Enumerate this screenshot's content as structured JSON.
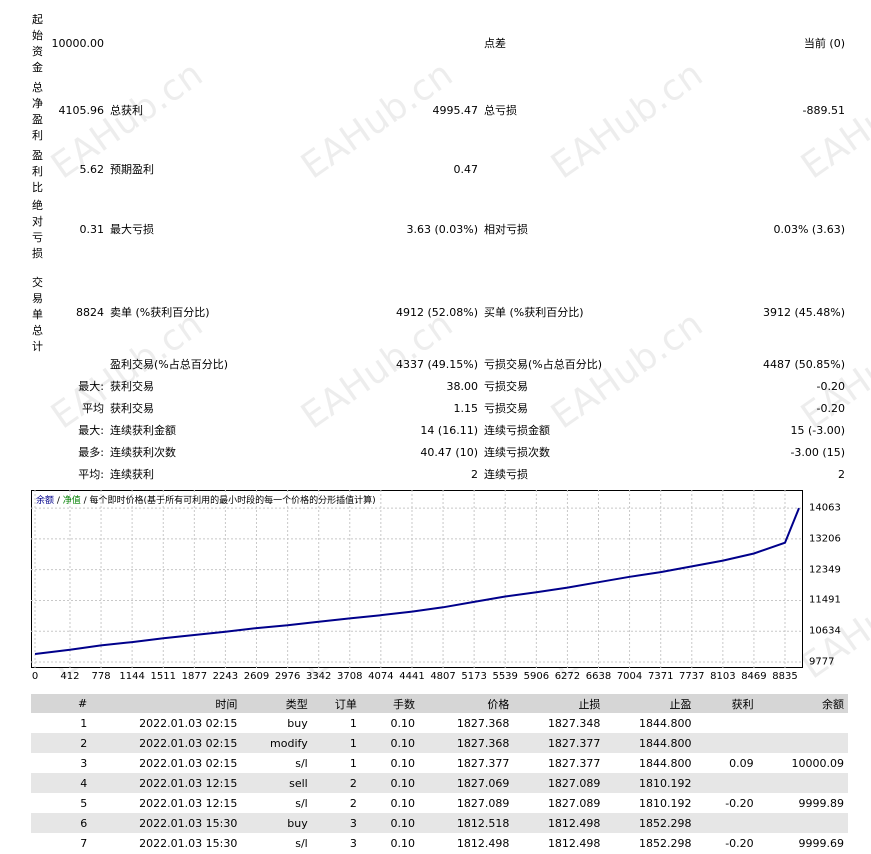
{
  "summary": {
    "initial_deposit": {
      "label": "起始资金",
      "value": "10000.00",
      "spread_label": "点差",
      "spread_value": "当前 (0)"
    },
    "total_net_profit": {
      "label": "总净盈利",
      "value": "4105.96",
      "gross_profit_label": "总获利",
      "gross_profit_value": "4995.47",
      "gross_loss_label": "总亏损",
      "gross_loss_value": "-889.51"
    },
    "profit_factor": {
      "label": "盈利比",
      "value": "5.62",
      "expected_label": "预期盈利",
      "expected_value": "0.47"
    },
    "absolute_drawdown": {
      "label": "绝对亏损",
      "value": "0.31",
      "maximal_label": "最大亏损",
      "maximal_value": "3.63 (0.03%)",
      "relative_label": "相对亏损",
      "relative_value": "0.03% (3.63)"
    },
    "total_trades": {
      "label": "交易单总计",
      "value": "8824",
      "short_label": "卖单 (%获利百分比)",
      "short_value": "4912 (52.08%)",
      "long_label": "买单 (%获利百分比)",
      "long_value": "3912 (45.48%)"
    },
    "profit_trades": {
      "label": "盈利交易(%占总百分比)",
      "value": "4337 (49.15%)",
      "loss_label": "亏损交易(%占总百分比)",
      "loss_value": "4487 (50.85%)"
    },
    "largest": {
      "prefix": "最大:",
      "profit_label": "获利交易",
      "profit_value": "38.00",
      "loss_label": "亏损交易",
      "loss_value": "-0.20"
    },
    "average": {
      "prefix": "平均",
      "profit_label": "获利交易",
      "profit_value": "1.15",
      "loss_label": "亏损交易",
      "loss_value": "-0.20"
    },
    "max_consec_amount": {
      "prefix": "最大:",
      "win_label": "连续获利金额",
      "win_value": "14 (16.11)",
      "loss_label": "连续亏损金额",
      "loss_value": "15 (-3.00)"
    },
    "max_consec_count": {
      "prefix": "最多:",
      "win_label": "连续获利次数",
      "win_value": "40.47 (10)",
      "loss_label": "连续亏损次数",
      "loss_value": "-3.00 (15)"
    },
    "avg_consec": {
      "prefix": "平均:",
      "win_label": "连续获利",
      "win_value": "2",
      "loss_label": "连续亏损",
      "loss_value": "2"
    }
  },
  "chart": {
    "legend_balance": "余额",
    "legend_sep1": " / ",
    "legend_equity": "净值",
    "legend_rest": " / 每个即时价格(基于所有可利用的最小时段的每一个价格的分形插值计算)",
    "balance_color": "#00008b",
    "equity_color": "#008000"
  },
  "chart_data": {
    "type": "line",
    "x_ticks": [
      "0",
      "412",
      "778",
      "1144",
      "1511",
      "1877",
      "2243",
      "2609",
      "2976",
      "3342",
      "3708",
      "4074",
      "4441",
      "4807",
      "5173",
      "5539",
      "5906",
      "6272",
      "6638",
      "7004",
      "7371",
      "7737",
      "8103",
      "8469",
      "8835"
    ],
    "y_ticks": [
      "14063",
      "13206",
      "12349",
      "11491",
      "10634",
      "9777"
    ],
    "xlim": [
      0,
      9000
    ],
    "ylim": [
      9777,
      14400
    ],
    "series": [
      {
        "values": [
          [
            0,
            10000
          ],
          [
            412,
            10120
          ],
          [
            778,
            10240
          ],
          [
            1144,
            10330
          ],
          [
            1511,
            10440
          ],
          [
            1877,
            10530
          ],
          [
            2243,
            10620
          ],
          [
            2609,
            10720
          ],
          [
            2976,
            10800
          ],
          [
            3342,
            10900
          ],
          [
            3708,
            10990
          ],
          [
            4074,
            11080
          ],
          [
            4441,
            11180
          ],
          [
            4807,
            11300
          ],
          [
            5173,
            11450
          ],
          [
            5539,
            11600
          ],
          [
            5906,
            11720
          ],
          [
            6272,
            11850
          ],
          [
            6638,
            12000
          ],
          [
            7004,
            12150
          ],
          [
            7371,
            12280
          ],
          [
            7737,
            12440
          ],
          [
            8103,
            12600
          ],
          [
            8469,
            12800
          ],
          [
            8835,
            13100
          ],
          [
            9000,
            14063
          ]
        ]
      }
    ]
  },
  "table": {
    "headers": [
      "#",
      "时间",
      "类型",
      "订单",
      "手数",
      "价格",
      "止损",
      "止盈",
      "获利",
      "余额"
    ],
    "rows": [
      [
        "1",
        "2022.01.03 02:15",
        "buy",
        "1",
        "0.10",
        "1827.368",
        "1827.348",
        "1844.800",
        "",
        ""
      ],
      [
        "2",
        "2022.01.03 02:15",
        "modify",
        "1",
        "0.10",
        "1827.368",
        "1827.377",
        "1844.800",
        "",
        ""
      ],
      [
        "3",
        "2022.01.03 02:15",
        "s/l",
        "1",
        "0.10",
        "1827.377",
        "1827.377",
        "1844.800",
        "0.09",
        "10000.09"
      ],
      [
        "4",
        "2022.01.03 12:15",
        "sell",
        "2",
        "0.10",
        "1827.069",
        "1827.089",
        "1810.192",
        "",
        ""
      ],
      [
        "5",
        "2022.01.03 12:15",
        "s/l",
        "2",
        "0.10",
        "1827.089",
        "1827.089",
        "1810.192",
        "-0.20",
        "9999.89"
      ],
      [
        "6",
        "2022.01.03 15:30",
        "buy",
        "3",
        "0.10",
        "1812.518",
        "1812.498",
        "1852.298",
        "",
        ""
      ],
      [
        "7",
        "2022.01.03 15:30",
        "s/l",
        "3",
        "0.10",
        "1812.498",
        "1812.498",
        "1852.298",
        "-0.20",
        "9999.69"
      ]
    ]
  },
  "watermark": "EAHub.cn"
}
